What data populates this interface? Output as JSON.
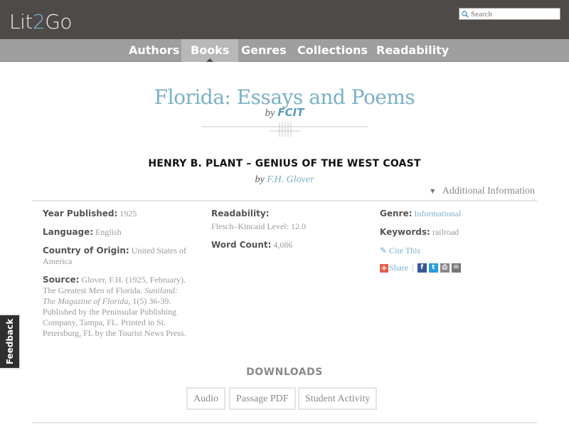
{
  "header": {
    "logo_left": "Lit",
    "logo_num": "2",
    "logo_right": "Go",
    "search_placeholder": "Search"
  },
  "nav": {
    "items": [
      "Authors",
      "Books",
      "Genres",
      "Collections",
      "Readability"
    ],
    "active": "Books"
  },
  "book": {
    "title": "Florida: Essays and Poems",
    "by": "by",
    "author": "FCIT"
  },
  "passage": {
    "title": "HENRY B. PLANT – GENIUS OF THE WEST COAST",
    "by": "by",
    "author": "F.H. Glover"
  },
  "additional_info": "Additional Information",
  "details": {
    "year_label": "Year Published:",
    "year": "1925",
    "language_label": "Language:",
    "language": "English",
    "country_label": "Country of Origin:",
    "country": "United States of America",
    "source_label": "Source:",
    "source_pre": "Glover, F.H. (1925, February). The Greatest Men of Florida.",
    "source_italic": "Suniland: The Magazine of Florida",
    "source_post": ", 1(5) 36-39. Published by the Peninsular Publishing Company, Tampa, FL. Printed in St. Petersburg, FL by the Tourist News Press.",
    "readability_label": "Readability:",
    "readability": "Flesch–Kincaid Level: 12.0",
    "wordcount_label": "Word Count:",
    "wordcount": "4,086",
    "genre_label": "Genre:",
    "genre": "Informational",
    "keywords_label": "Keywords:",
    "keywords": "railroad",
    "cite": "Cite This",
    "share": "Share",
    "share_separator": "|"
  },
  "downloads": {
    "heading": "DOWNLOADS",
    "buttons": [
      "Audio",
      "Passage PDF",
      "Student Activity"
    ]
  },
  "feedback": "Feedback",
  "colors": {
    "topbar": "#4e4a47",
    "navbar": "#9e9e9e",
    "accent": "#7ab0c9",
    "share_plus": "#e25f4f",
    "facebook": "#3b5998",
    "twitter": "#2a9fd8"
  },
  "icons": {
    "search": "magnifier-icon",
    "cite": "pencil-icon",
    "share": "plus-icon",
    "facebook": "facebook-icon",
    "twitter": "twitter-icon",
    "print": "print-icon",
    "email": "email-icon",
    "additional": "triangle-down-icon"
  }
}
